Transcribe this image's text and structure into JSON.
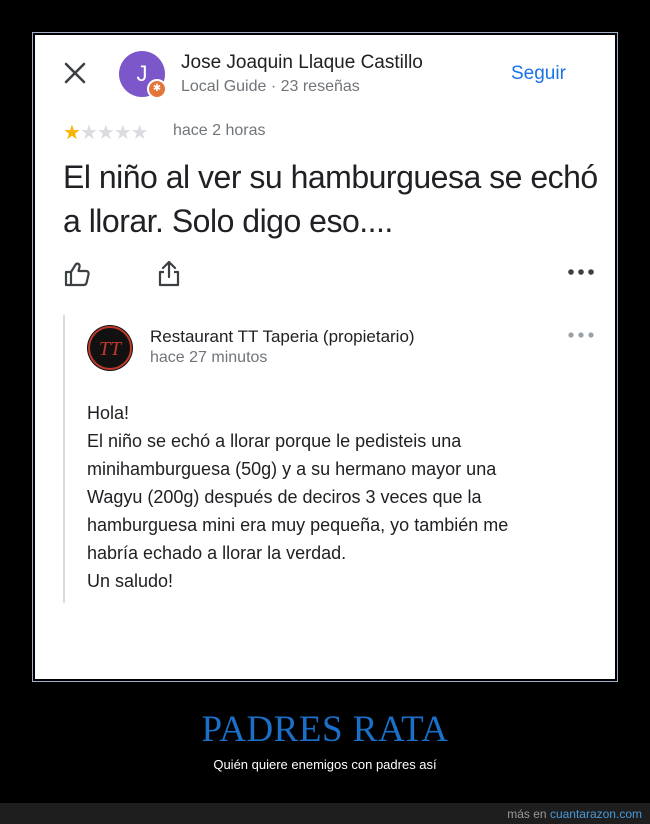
{
  "review": {
    "author_name": "Jose Joaquin Llaque Castillo",
    "author_initial": "J",
    "author_meta": "Local Guide · 23 reseñas",
    "follow_label": "Seguir",
    "rating": 1,
    "max_rating": 5,
    "time": "hace 2 horas",
    "text": "El niño al ver su hamburguesa se echó a llorar. Solo digo eso....",
    "colors": {
      "avatar": "#7b57c9",
      "badge": "#e2763a",
      "follow": "#1a73e8",
      "star": "#f6b400"
    },
    "icons": [
      "close-icon",
      "like-icon",
      "share-icon",
      "more-icon"
    ]
  },
  "owner_reply": {
    "owner_name": "Restaurant TT Taperia (propietario)",
    "time": "hace 27 minutos",
    "logo_text": "TT",
    "lines": [
      "Hola!",
      "El niño se echó a llorar porque le pedisteis una",
      "minihamburguesa (50g) y a su hermano mayor una",
      "Wagyu (200g) después de deciros 3 veces que la",
      "hamburguesa mini era muy pequeña, yo también me",
      "habría echado a llorar la verdad.",
      "Un saludo!"
    ]
  },
  "meme": {
    "title": "PADRES RATA",
    "subtitle": "Quién quiere enemigos con padres así",
    "footer_prefix": "más en ",
    "footer_link": "cuantarazon.com",
    "title_color": "#1a6fc9"
  }
}
